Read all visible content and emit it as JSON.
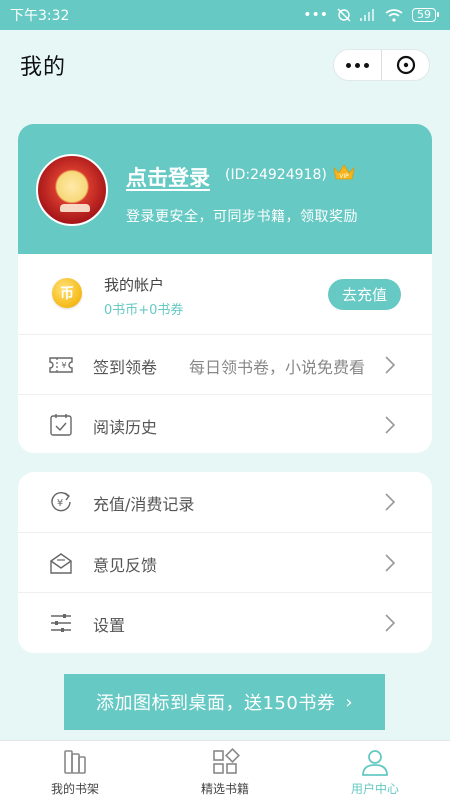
{
  "status_bar": {
    "time": "下午3:32",
    "battery": "59"
  },
  "header": {
    "title": "我的"
  },
  "profile": {
    "login_label": "点击登录",
    "user_id": "(ID:24924918)",
    "vip_badge": "VIP",
    "description": "登录更安全，可同步书籍，领取奖励"
  },
  "account": {
    "coin_icon_text": "币",
    "title": "我的帐户",
    "balance": "0书币+0书券",
    "recharge_label": "去充值"
  },
  "menu_card_1": [
    {
      "label": "签到领卷",
      "desc": "每日领书卷，小说免费看",
      "icon": "ticket-icon"
    },
    {
      "label": "阅读历史",
      "desc": "",
      "icon": "calendar-check-icon"
    }
  ],
  "menu_card_2": [
    {
      "label": "充值/消费记录",
      "icon": "yuan-refresh-icon"
    },
    {
      "label": "意见反馈",
      "icon": "mail-feedback-icon"
    },
    {
      "label": "设置",
      "icon": "sliders-icon"
    }
  ],
  "promo": {
    "label": "添加图标到桌面，送150书券",
    "arrow": "›"
  },
  "bottom_nav": [
    {
      "label": "我的书架",
      "icon": "bookshelf-icon",
      "active": false
    },
    {
      "label": "精选书籍",
      "icon": "grid-apps-icon",
      "active": false
    },
    {
      "label": "用户中心",
      "icon": "user-icon",
      "active": true
    }
  ],
  "colors": {
    "accent": "#66c9c4",
    "background": "#e6f7f6",
    "coin": "#f7bf23"
  }
}
